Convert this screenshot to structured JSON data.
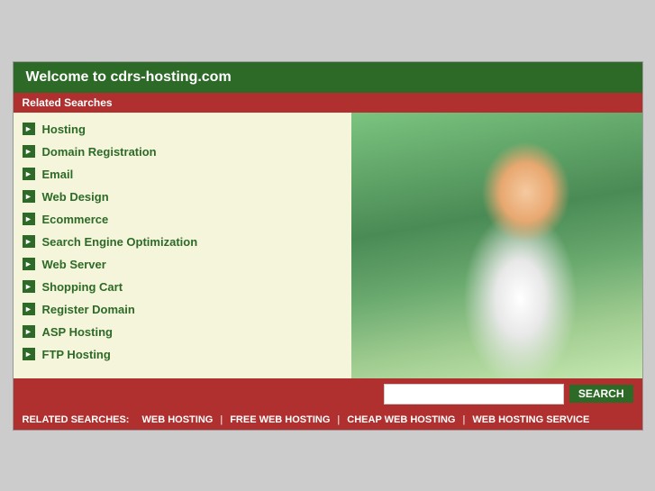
{
  "header": {
    "title": "Welcome to cdrs-hosting.com"
  },
  "relatedSearches": {
    "label": "Related Searches"
  },
  "links": [
    {
      "label": "Hosting",
      "id": "hosting"
    },
    {
      "label": "Domain Registration",
      "id": "domain-registration"
    },
    {
      "label": "Email",
      "id": "email"
    },
    {
      "label": "Web Design",
      "id": "web-design"
    },
    {
      "label": "Ecommerce",
      "id": "ecommerce"
    },
    {
      "label": "Search Engine Optimization",
      "id": "seo"
    },
    {
      "label": "Web Server",
      "id": "web-server"
    },
    {
      "label": "Shopping Cart",
      "id": "shopping-cart"
    },
    {
      "label": "Register Domain",
      "id": "register-domain"
    },
    {
      "label": "ASP Hosting",
      "id": "asp-hosting"
    },
    {
      "label": "FTP Hosting",
      "id": "ftp-hosting"
    }
  ],
  "search": {
    "placeholder": "",
    "button_label": "SEARCH"
  },
  "bottomBar": {
    "label": "RELATED SEARCHES:",
    "links": [
      {
        "label": "WEB HOSTING"
      },
      {
        "label": "FREE WEB HOSTING"
      },
      {
        "label": "CHEAP WEB HOSTING"
      },
      {
        "label": "WEB HOSTING SERVICE"
      }
    ]
  },
  "icons": {
    "arrow": "►"
  }
}
